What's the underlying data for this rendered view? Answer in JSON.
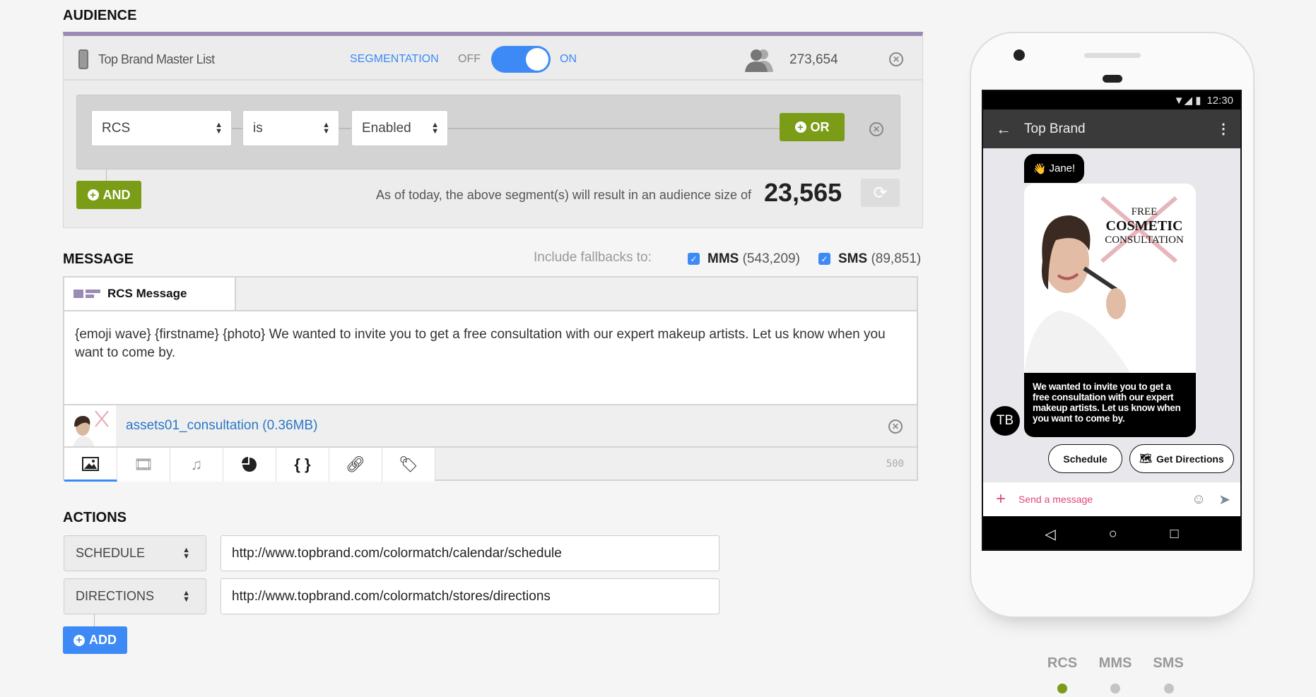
{
  "audience": {
    "title": "AUDIENCE",
    "list_name": "Top Brand Master List",
    "segmentation_label": "SEGMENTATION",
    "toggle_off": "OFF",
    "toggle_on": "ON",
    "segmentation_enabled": true,
    "list_count": "273,654",
    "segment": {
      "field": "RCS",
      "operator": "is",
      "value": "Enabled"
    },
    "or_label": "OR",
    "and_label": "AND",
    "summary_text": "As of today, the above segment(s) will result in an audience size of",
    "audience_size": "23,565"
  },
  "message": {
    "title": "MESSAGE",
    "fallbacks_label": "Include fallbacks to:",
    "fallbacks": [
      {
        "label": "MMS",
        "count": "(543,209)",
        "checked": true
      },
      {
        "label": "SMS",
        "count": "(89,851)",
        "checked": true
      }
    ],
    "tab_label": "RCS Message",
    "body": "{emoji wave} {firstname} {photo} We wanted to invite you to get a free consultation with our expert makeup artists. Let us know when you want to come by.",
    "attachment": "assets01_consultation (0.36MB)",
    "tools": [
      "image-icon",
      "film-icon",
      "music-icon",
      "pie-chart-icon",
      "braces-icon",
      "link-icon",
      "tag-icon"
    ],
    "char_count": "500"
  },
  "actions": {
    "title": "ACTIONS",
    "rows": [
      {
        "type": "SCHEDULE",
        "url": "http://www.topbrand.com/colormatch/calendar/schedule"
      },
      {
        "type": "DIRECTIONS",
        "url": "http://www.topbrand.com/colormatch/stores/directions"
      }
    ],
    "add_label": "ADD"
  },
  "preview": {
    "time": "12:30",
    "brand": "Top Brand",
    "greeting": "Jane!",
    "image_text": {
      "line1": "FREE",
      "line2": "COSMETIC",
      "line3": "CONSULTATION"
    },
    "card_text": "We wanted to invite you to get a free consultation with our expert makeup artists. Let us know when you want to come by.",
    "avatar": "TB",
    "chips": [
      "Schedule",
      "Get Directions"
    ],
    "input_placeholder": "Send a message",
    "tabs": [
      "RCS",
      "MMS",
      "SMS"
    ],
    "active_tab": "RCS"
  },
  "colors": {
    "accent_green": "#7a9c16",
    "blue": "#3d8af7",
    "purple": "#9a8bb4"
  }
}
